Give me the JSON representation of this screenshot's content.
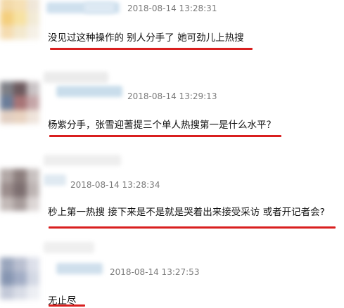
{
  "comments": [
    {
      "timestamp": "2018-08-14 13:28:31",
      "text": "没见过这种操作的 别人分手了 她可劲儿上热搜"
    },
    {
      "timestamp": "2018-08-14 13:29:13",
      "text": "杨紫分手，张雪迎蓍提三个单人热搜第一是什么水平？"
    },
    {
      "timestamp": "2018-08-14 13:28:34",
      "text": "秒上第一热搜 接下来是不是就是哭着出来接受采访 或者开记者会?"
    },
    {
      "timestamp": "2018-08-14 13:27:53",
      "text": "无止尽"
    }
  ],
  "colors": {
    "underline": "#d91f1f",
    "timestamp": "#7a7a7a",
    "text": "#111111"
  }
}
